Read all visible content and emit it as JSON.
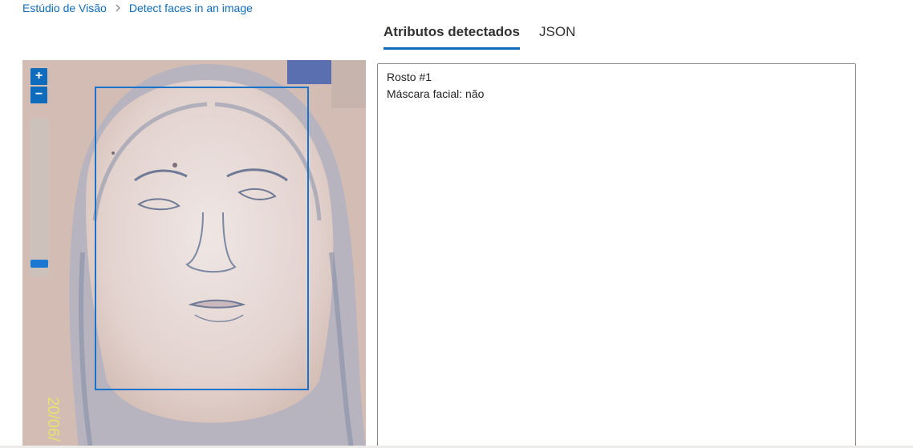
{
  "breadcrumb": {
    "root_label": "Estúdio de Visão",
    "current_label": "Detect faces in an image"
  },
  "tabs": [
    {
      "label": "Atributos detectados",
      "active": true
    },
    {
      "label": "JSON",
      "active": false
    }
  ],
  "image_viewer": {
    "zoom_in_label": "+",
    "zoom_out_label": "−",
    "zoom_level_fraction": 0.05,
    "face_box_color": "#1a73c8",
    "photo_date_stamp": "20/06/"
  },
  "results": {
    "face_title": "Rosto #1",
    "mask_line": "Máscara facial: não"
  },
  "colors": {
    "accent": "#0f6cbd"
  }
}
